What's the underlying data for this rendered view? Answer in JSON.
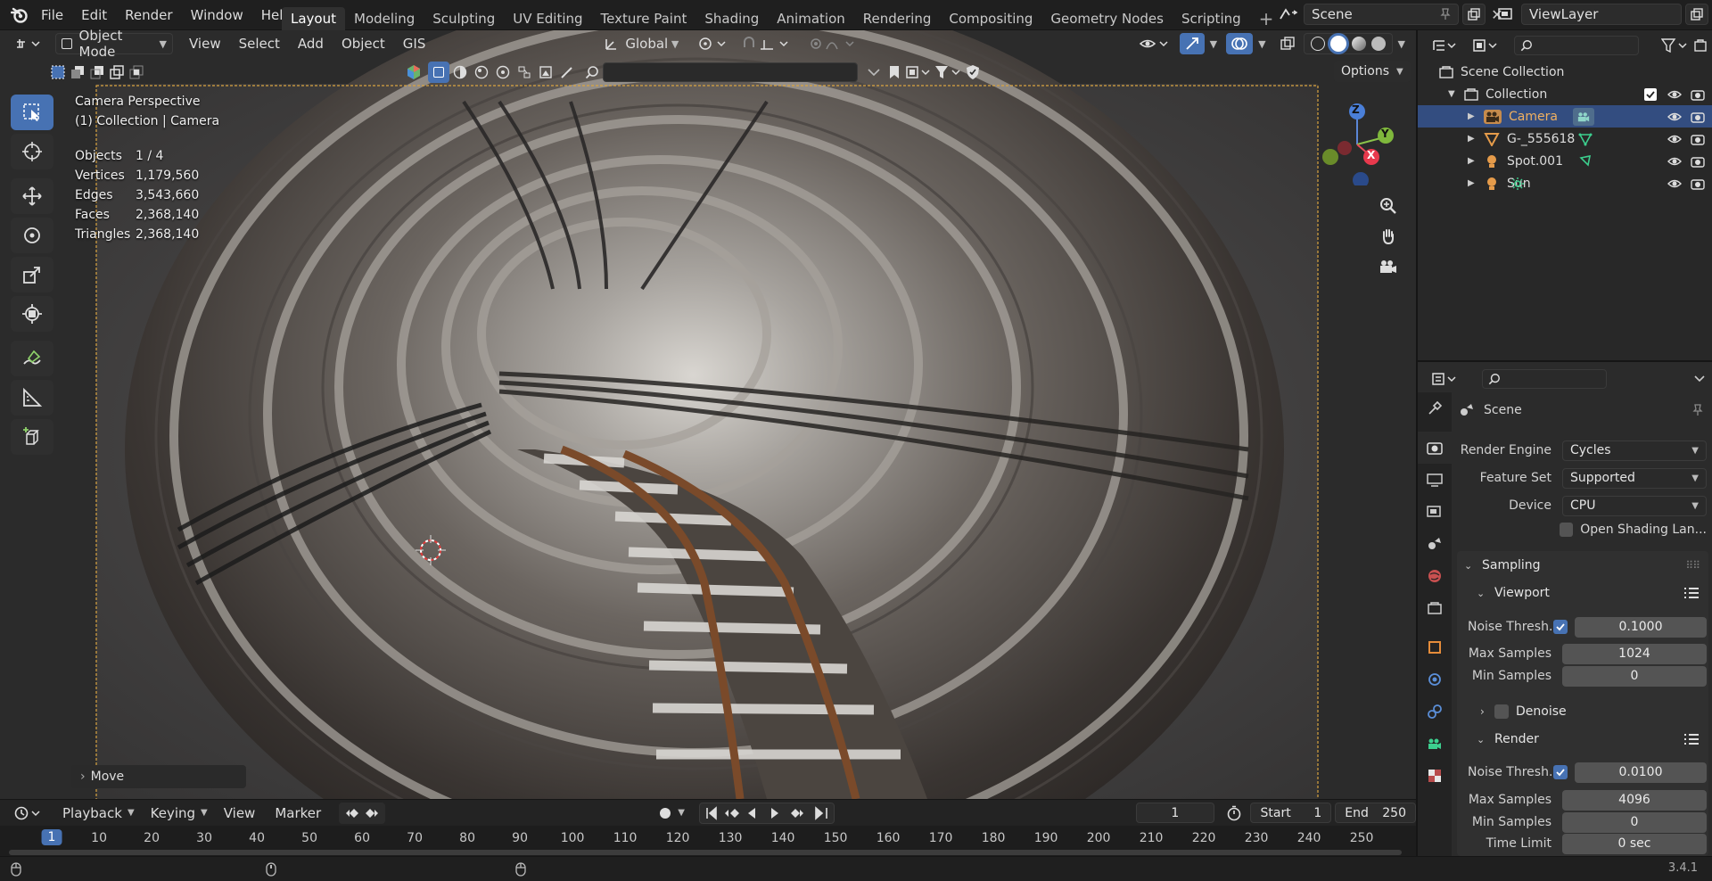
{
  "menu": {
    "items": [
      "File",
      "Edit",
      "Render",
      "Window",
      "Help"
    ]
  },
  "workspaces": [
    "Layout",
    "Modeling",
    "Sculpting",
    "UV Editing",
    "Texture Paint",
    "Shading",
    "Animation",
    "Rendering",
    "Compositing",
    "Geometry Nodes",
    "Scripting"
  ],
  "active_workspace": "Layout",
  "scene_name": "Scene",
  "view_layer": "ViewLayer",
  "viewport_header": {
    "mode": "Object Mode",
    "menus": [
      "View",
      "Select",
      "Add",
      "Object",
      "GIS"
    ],
    "transform_orientation": "Global",
    "options_label": "Options"
  },
  "viewport_overlay": {
    "camera_line1": "Camera Perspective",
    "camera_line2": "(1) Collection | Camera",
    "stats": [
      {
        "k": "Objects",
        "v": "1 / 4"
      },
      {
        "k": "Vertices",
        "v": "1,179,560"
      },
      {
        "k": "Edges",
        "v": "3,543,660"
      },
      {
        "k": "Faces",
        "v": "2,368,140"
      },
      {
        "k": "Triangles",
        "v": "2,368,140"
      }
    ],
    "last_op": "Move"
  },
  "gizmo": {
    "z": "Z",
    "y": "Y",
    "x": "X"
  },
  "outliner": {
    "root": "Scene Collection",
    "collection": "Collection",
    "objects": [
      {
        "name": "Camera",
        "selected": true,
        "icon": "camera-icon"
      },
      {
        "name": "G-_555618",
        "selected": false,
        "icon": "mesh-icon"
      },
      {
        "name": "Spot.001",
        "selected": false,
        "icon": "light-icon"
      },
      {
        "name": "Sun",
        "selected": false,
        "icon": "sun-icon"
      }
    ]
  },
  "properties": {
    "context": "Scene",
    "render_engine_label": "Render Engine",
    "render_engine": "Cycles",
    "feature_set_label": "Feature Set",
    "feature_set": "Supported",
    "device_label": "Device",
    "device": "CPU",
    "osl_label": "Open Shading Lan...",
    "sampling": "Sampling",
    "viewport": "Viewport",
    "vp_noise_label": "Noise Thresh...",
    "vp_noise": "0.1000",
    "vp_max_label": "Max Samples",
    "vp_max": "1024",
    "vp_min_label": "Min Samples",
    "vp_min": "0",
    "denoise": "Denoise",
    "render": "Render",
    "r_noise_label": "Noise Thresh...",
    "r_noise": "0.0100",
    "r_max_label": "Max Samples",
    "r_max": "4096",
    "r_min_label": "Min Samples",
    "r_min": "0",
    "time_limit_label": "Time Limit",
    "time_limit": "0 sec"
  },
  "timeline": {
    "menus": [
      "Playback",
      "Keying",
      "View",
      "Marker"
    ],
    "current_frame": "1",
    "start_label": "Start",
    "start": "1",
    "end_label": "End",
    "end": "250",
    "ticks": [
      "1",
      "10",
      "20",
      "30",
      "40",
      "50",
      "60",
      "70",
      "80",
      "90",
      "100",
      "110",
      "120",
      "130",
      "140",
      "150",
      "160",
      "170",
      "180",
      "190",
      "200",
      "210",
      "220",
      "230",
      "240",
      "250"
    ]
  },
  "version": "3.4.1",
  "colors": {
    "accent": "#4772b3",
    "selected_row": "#334d80",
    "camera_frame": "#d9a441"
  }
}
